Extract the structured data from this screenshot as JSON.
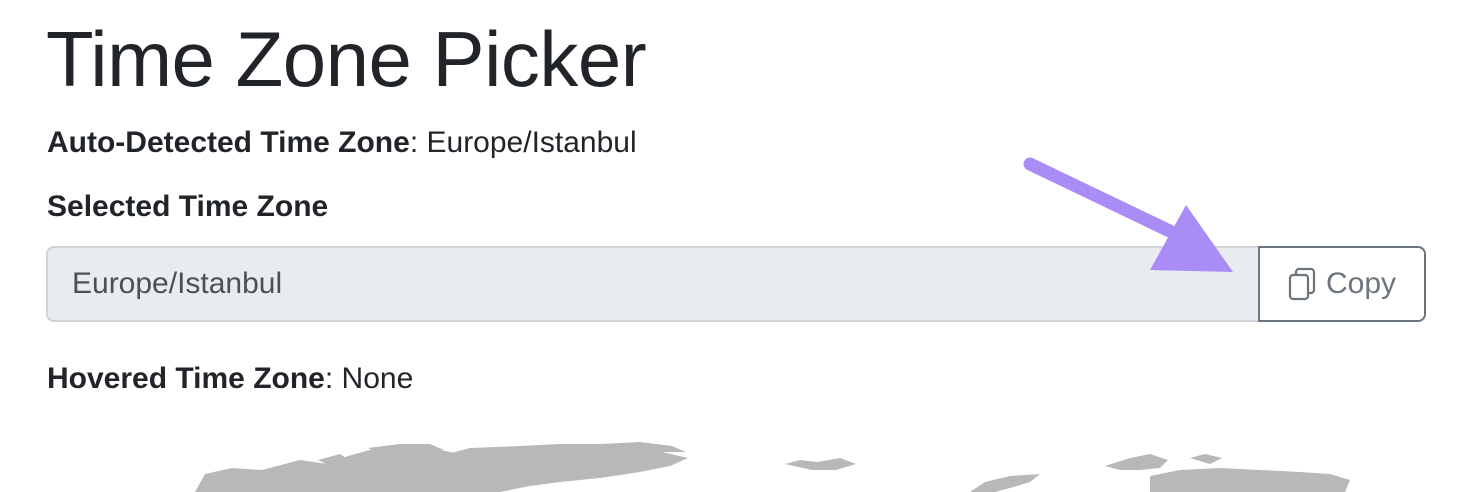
{
  "page": {
    "title": "Time Zone Picker"
  },
  "auto_detected": {
    "label": "Auto-Detected Time Zone",
    "separator": ":",
    "value": "Europe/Istanbul"
  },
  "selected": {
    "label": "Selected Time Zone",
    "input_value": "Europe/Istanbul",
    "copy_label": "Copy",
    "copy_icon": "copy-icon"
  },
  "hovered": {
    "label": "Hovered Time Zone",
    "separator": ":",
    "value": "None"
  },
  "colors": {
    "annotation_arrow": "#a98cf6",
    "map_land": "#b8b8b8",
    "input_bg": "#e9ecef",
    "button_border": "#6c757d"
  }
}
